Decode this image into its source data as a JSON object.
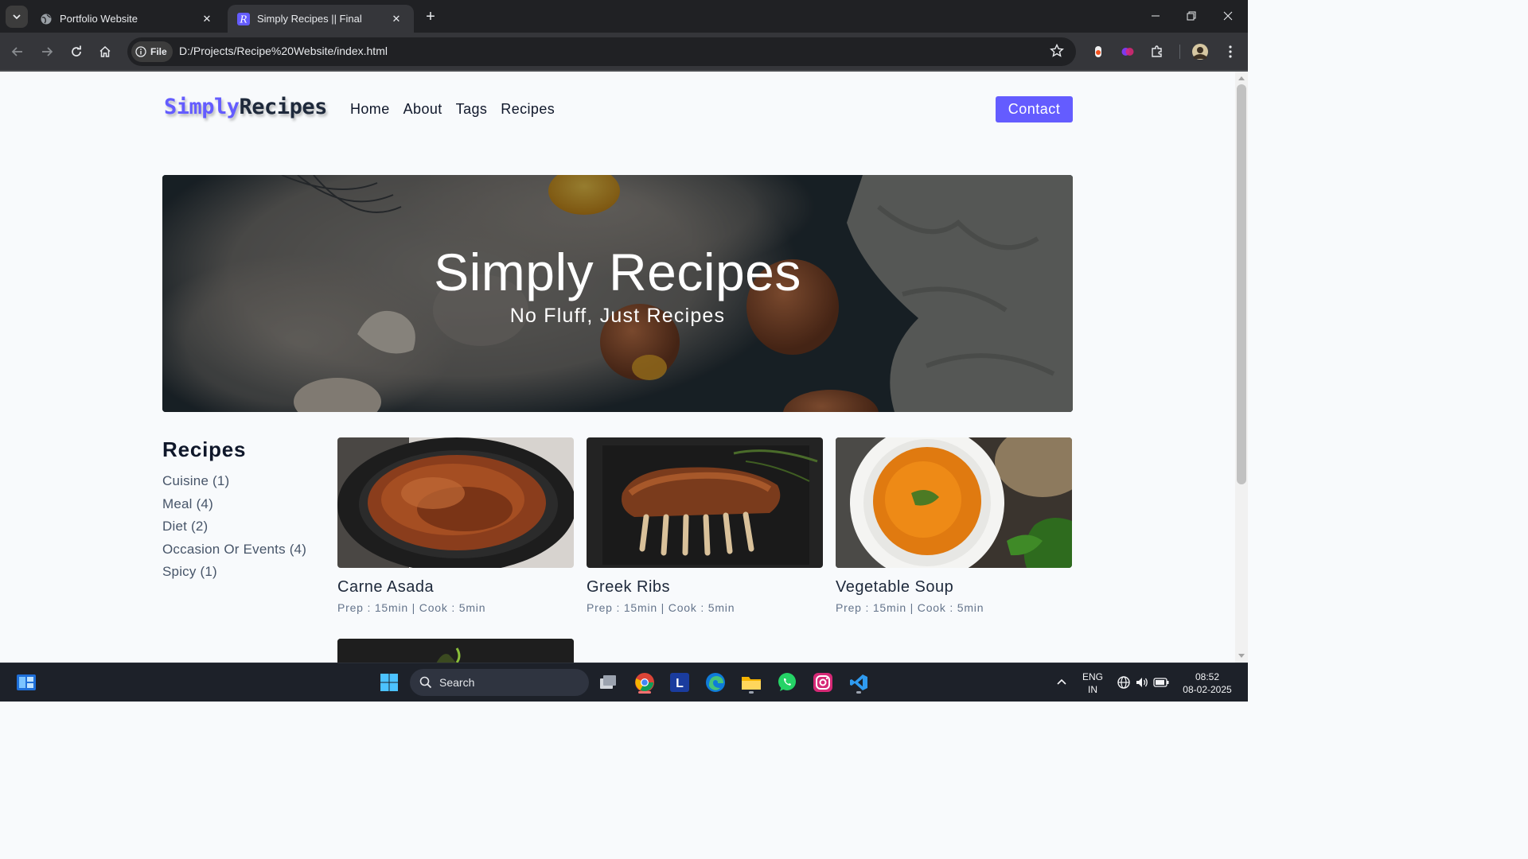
{
  "browser": {
    "tabs": [
      {
        "title": "Portfolio Website",
        "active": false
      },
      {
        "title": "Simply Recipes || Final",
        "active": true
      }
    ],
    "site_chip": "File",
    "url": "D:/Projects/Recipe%20Website/index.html"
  },
  "site": {
    "logo_part1": "Simply",
    "logo_part2": "Recipes",
    "nav": [
      "Home",
      "About",
      "Tags",
      "Recipes"
    ],
    "contact_label": "Contact",
    "hero": {
      "title": "Simply Recipes",
      "subtitle": "No Fluff, Just Recipes"
    },
    "sidebar": {
      "title": "Recipes",
      "tags": [
        "Cuisine (1)",
        "Meal (4)",
        "Diet (2)",
        "Occasion Or Events (4)",
        "Spicy (1)"
      ]
    },
    "recipes": [
      {
        "name": "Carne Asada",
        "meta": "Prep : 15min | Cook : 5min"
      },
      {
        "name": "Greek Ribs",
        "meta": "Prep : 15min | Cook : 5min"
      },
      {
        "name": "Vegetable Soup",
        "meta": "Prep : 15min | Cook : 5min"
      }
    ],
    "accent_color": "#645cff"
  },
  "taskbar": {
    "search_label": "Search",
    "language": "ENG",
    "region": "IN",
    "time": "08:52",
    "date": "08-02-2025"
  }
}
